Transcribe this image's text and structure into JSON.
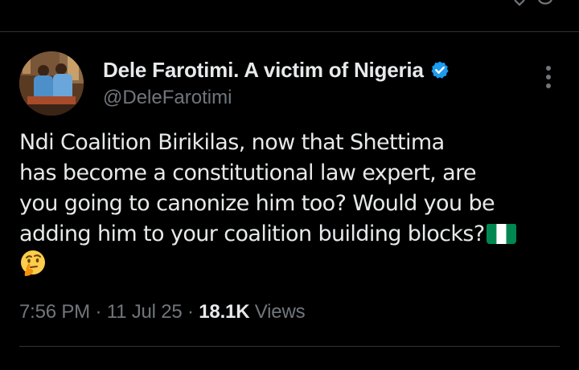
{
  "author": {
    "display_name": "Dele Farotimi. A victim of Nigeria",
    "handle": "@DeleFarotimi",
    "verified": true,
    "verified_badge_color": "#1d9bf0",
    "avatar_icon": "profile-photo"
  },
  "tweet": {
    "lines": [
      "Ndi Coalition Birikilas, now that Shettima",
      "has become a constitutional law expert, are",
      "you going to canonize him too? Would you be",
      "adding him to your coalition building blocks?"
    ],
    "emojis": [
      "nigeria-flag-icon",
      "thinking-face-icon"
    ]
  },
  "meta": {
    "time": "7:56 PM",
    "separator": "·",
    "date": "11 Jul 25",
    "views_count": "18.1K",
    "views_label": "Views"
  },
  "colors": {
    "background": "#000000",
    "primary_text": "#e7e9ea",
    "secondary_text": "#71767b",
    "divider": "#2f3336"
  }
}
